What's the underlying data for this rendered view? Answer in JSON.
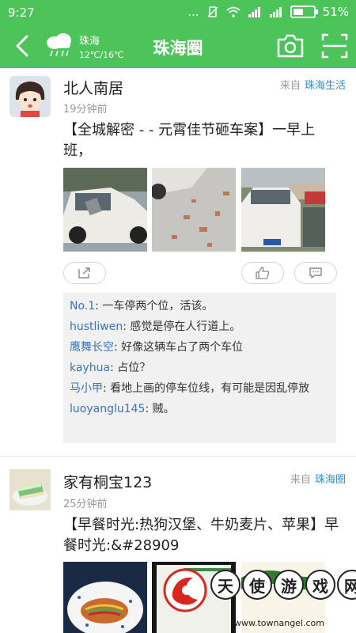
{
  "status": {
    "time": "9:27",
    "battery": "51%",
    "signal_dots": "..."
  },
  "header": {
    "weather_city": "珠海",
    "weather_temp": "12℃/16℃",
    "title": "珠海圈"
  },
  "posts": [
    {
      "user": "北人南居",
      "time": "19分钟前",
      "from_label": "来自",
      "from_source": "珠海生活",
      "text": "【全城解密 - - 元霄佳节砸车案】一早上班，",
      "comments": [
        {
          "user": "No.1",
          "text": ": 一车停两个位，活该。"
        },
        {
          "user": "hustliwen",
          "text": ": 感觉是停在人行道上。"
        },
        {
          "user": "鹰舞长空",
          "text": ": 好像这辆车占了两个车位"
        },
        {
          "user": "kayhua",
          "text": ": 占位？"
        },
        {
          "user": "马小甲",
          "text": ": 看地上画的停车位线，有可能是因乱停放"
        },
        {
          "user": "luoyanglu145",
          "text": ": 贼。"
        }
      ]
    },
    {
      "user": "家有桐宝123",
      "time": "25分钟前",
      "from_label": "来自",
      "from_source": "珠海圈",
      "text": "【早餐时光:热狗汉堡、牛奶麦片、苹果】早餐时光:&#28909"
    }
  ],
  "watermark": {
    "chars": [
      "天",
      "使",
      "游",
      "戏",
      "网"
    ],
    "url": "www.townangel.com"
  },
  "colors": {
    "brand": "#4cc45a",
    "link": "#2a8fd6",
    "comment_user": "#3a74b8"
  },
  "icons": [
    "back-arrow-icon",
    "cloud-rain-icon",
    "camera-icon",
    "scan-icon",
    "share-icon",
    "like-icon",
    "comment-icon"
  ]
}
